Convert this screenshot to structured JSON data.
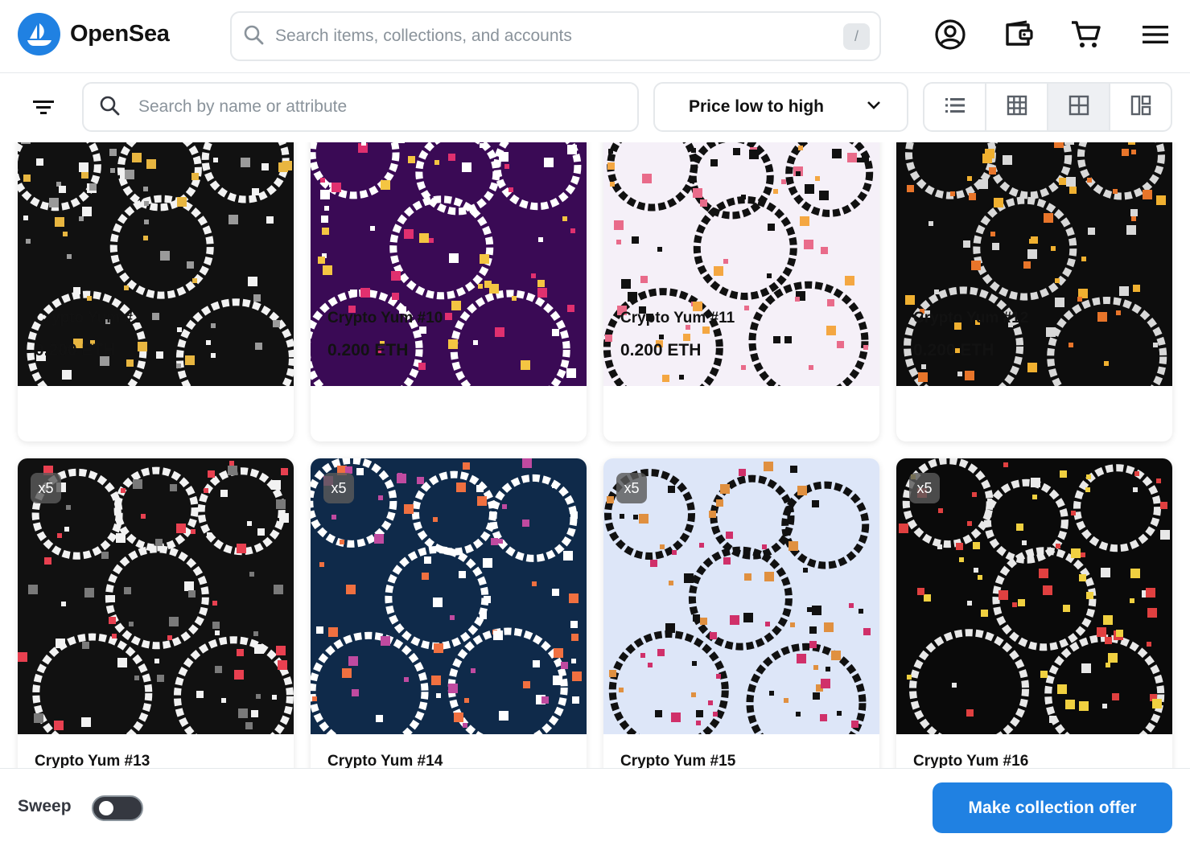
{
  "header": {
    "brand": "OpenSea",
    "search_placeholder": "Search items, collections, and accounts",
    "search_shortcut": "/",
    "icons": [
      "logo-icon",
      "search-icon",
      "account-icon",
      "wallet-icon",
      "cart-icon",
      "menu-icon"
    ]
  },
  "toolbar": {
    "attribute_search_placeholder": "Search by name or attribute",
    "sort_label": "Price low to high",
    "view_modes": [
      "list-view-icon",
      "dense-grid-view-icon",
      "grid-view-icon",
      "large-grid-view-icon"
    ],
    "active_view": "grid-view-icon"
  },
  "items_row1": [
    {
      "name": "Crypto Yum #1",
      "price": "0.200 ETH",
      "palette": [
        "#111111",
        "#f2f2f2",
        "#9a9a9a",
        "#e8b640"
      ]
    },
    {
      "name": "Crypto Yum #10",
      "price": "0.200 ETH",
      "palette": [
        "#3a0a55",
        "#ffffff",
        "#e0306f",
        "#f4c542"
      ]
    },
    {
      "name": "Crypto Yum #11",
      "price": "0.200 ETH",
      "palette": [
        "#f5f0f8",
        "#111111",
        "#e96b8a",
        "#f4a742"
      ]
    },
    {
      "name": "Crypto Yum #12",
      "price": "0.200 ETH",
      "palette": [
        "#0d0d0d",
        "#d8d8d8",
        "#e8752a",
        "#f0b030"
      ]
    }
  ],
  "items_row2": [
    {
      "name": "Crypto Yum #13",
      "quantity": "x5",
      "palette": [
        "#111111",
        "#f2f2f2",
        "#7a7a7a",
        "#e84050"
      ]
    },
    {
      "name": "Crypto Yum #14",
      "quantity": "x5",
      "palette": [
        "#0f2a4a",
        "#ffffff",
        "#c04aa0",
        "#f07040"
      ]
    },
    {
      "name": "Crypto Yum #15",
      "quantity": "x5",
      "palette": [
        "#dde6f8",
        "#111111",
        "#d0306a",
        "#e09040"
      ]
    },
    {
      "name": "Crypto Yum #16",
      "quantity": "x5",
      "palette": [
        "#0a0a0a",
        "#e8e8e8",
        "#e04040",
        "#f0d040"
      ]
    }
  ],
  "footer": {
    "sweep_label": "Sweep",
    "sweep_enabled": false,
    "offer_button": "Make collection offer"
  },
  "colors": {
    "brand": "#2081e2",
    "border": "#e5e8eb",
    "placeholder": "#8a939b",
    "text": "#121212"
  }
}
